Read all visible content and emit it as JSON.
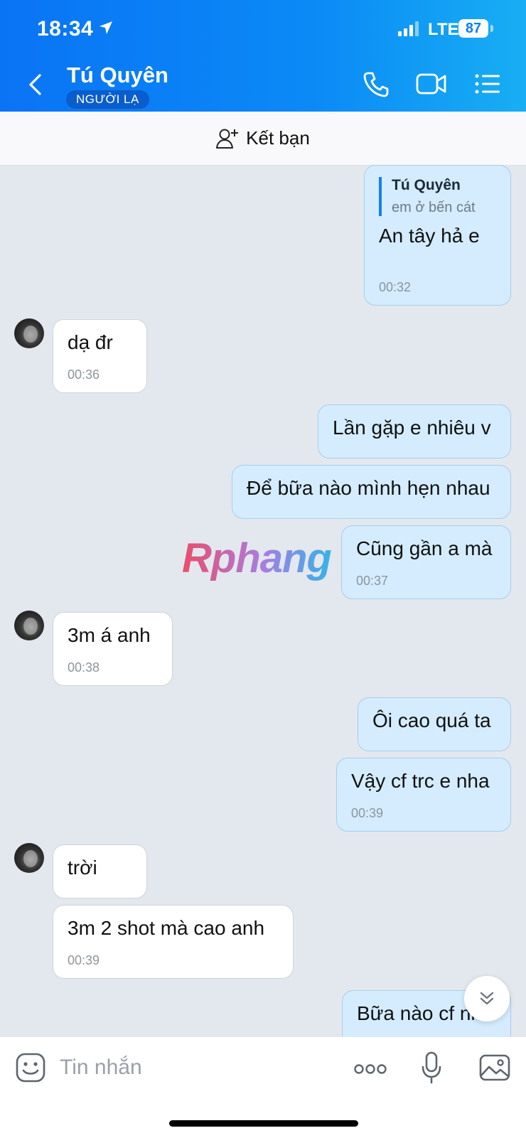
{
  "status_bar": {
    "time": "18:34",
    "network": "LTE",
    "battery": "87"
  },
  "header": {
    "contact_name": "Tú Quyên",
    "badge": "NGƯỜI LẠ"
  },
  "friend_bar": {
    "label": "Kết bạn"
  },
  "watermark": "Rphang",
  "messages": [
    {
      "dir": "out",
      "quote_name": "Tú Quyên",
      "quote_text": "em ở bến cát",
      "text": "An tây hả e",
      "time": "00:32"
    },
    {
      "dir": "in",
      "text": "dạ đr",
      "time": "00:36"
    },
    {
      "dir": "out",
      "text": "Lần gặp e nhiêu v"
    },
    {
      "dir": "out",
      "text": "Để bữa nào mình hẹn nhau"
    },
    {
      "dir": "out",
      "text": "Cũng gần a mà",
      "time": "00:37"
    },
    {
      "dir": "in",
      "text": "3m á anh",
      "time": "00:38"
    },
    {
      "dir": "out",
      "text": "Ôi cao quá ta"
    },
    {
      "dir": "out",
      "text": "Vậy cf trc e nha",
      "time": "00:39"
    },
    {
      "dir": "in",
      "text": "trời"
    },
    {
      "dir": "in",
      "text": "3m 2 shot mà cao anh",
      "time": "00:39"
    },
    {
      "dir": "out",
      "text": "Bữa nào cf nha"
    }
  ],
  "composer": {
    "placeholder": "Tin nhắn"
  },
  "colors": {
    "header_start": "#0a74f5",
    "header_end": "#18aef3",
    "bubble_out": "#d4ecfd",
    "bubble_in": "#ffffff",
    "chat_bg": "#e3e8ef"
  }
}
